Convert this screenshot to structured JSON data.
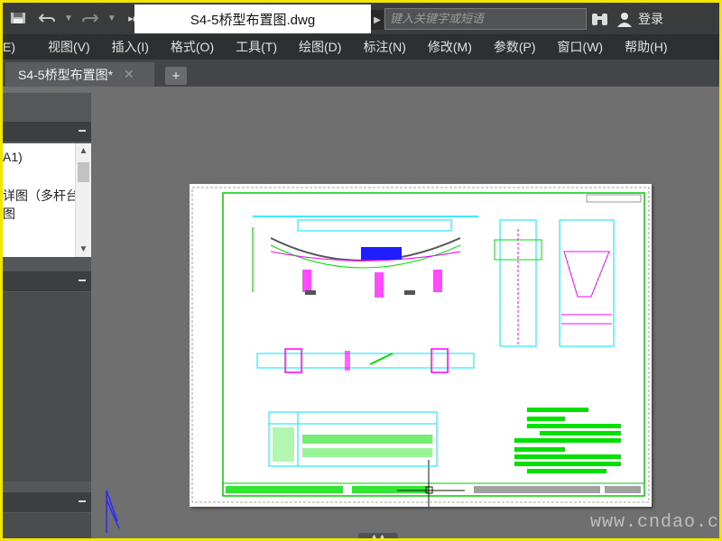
{
  "titlebar": {
    "doc_title": "S4-5桥型布置图.dwg",
    "search_placeholder": "键入关键字或短语",
    "login_label": "登录",
    "quick_access": [
      "save-icon",
      "undo-icon",
      "redo-icon",
      "more-icon"
    ]
  },
  "menu": {
    "items": [
      "E)",
      "视图(V)",
      "插入(I)",
      "格式(O)",
      "工具(T)",
      "绘图(D)",
      "标注(N)",
      "修改(M)",
      "参数(P)",
      "窗口(W)",
      "帮助(H)"
    ]
  },
  "tabs": {
    "file_tab": "S4-5桥型布置图*",
    "close_glyph": "✕",
    "add_glyph": "+"
  },
  "palette": {
    "list_items": [
      "A1)",
      "详图（多杆台",
      "图"
    ]
  },
  "watermark": "www.cndao.com",
  "colors": {
    "background_frame": "#f2e600",
    "drawing_green": "#00ff00",
    "drawing_cyan": "#00e5ff",
    "drawing_magenta": "#ff00ff"
  }
}
